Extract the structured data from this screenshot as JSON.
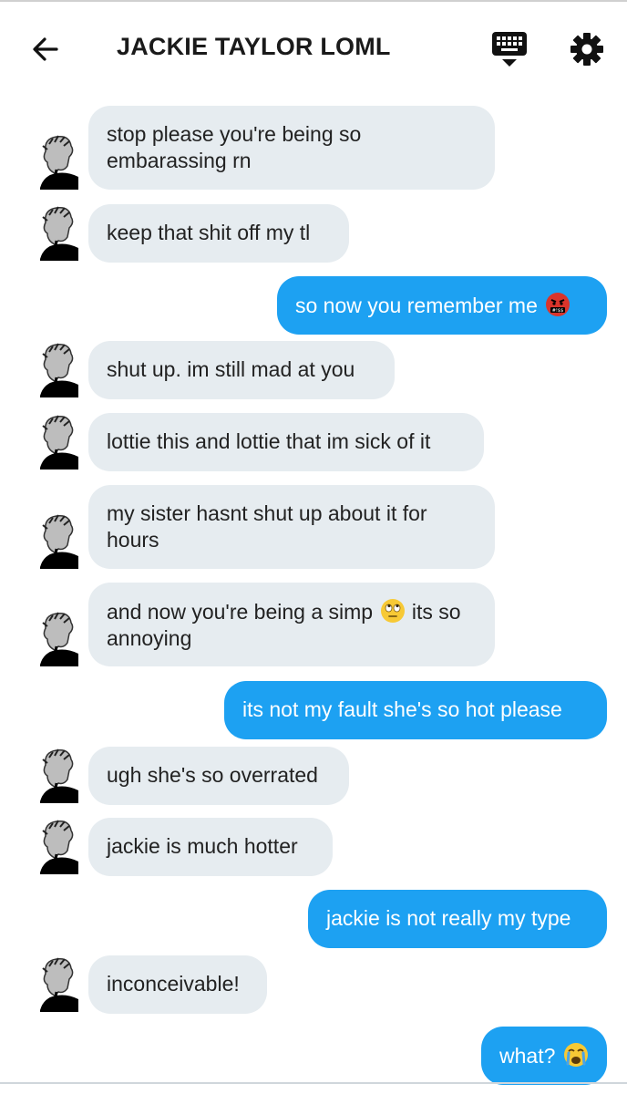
{
  "header": {
    "title": "JACKIE TAYLOR LOML",
    "icons": [
      "back-arrow-icon",
      "keyboard-icon",
      "gear-icon"
    ]
  },
  "messages": [
    {
      "side": "in",
      "text": "stop please you're being so embarassing rn"
    },
    {
      "side": "in",
      "text": "keep that shit off my tl"
    },
    {
      "side": "out",
      "text": "so now you remember me",
      "emoji": "angry-cursing-face"
    },
    {
      "side": "in",
      "text": "shut up. im still mad at you"
    },
    {
      "side": "in",
      "text": "lottie this and lottie that im sick of it"
    },
    {
      "side": "in",
      "text": "my sister hasnt shut up about it for hours"
    },
    {
      "side": "in",
      "text_before": "and now you're being a simp",
      "emoji": "eye-roll-face",
      "text_after": "its so annoying"
    },
    {
      "side": "out",
      "text": "its not my fault she's so hot please"
    },
    {
      "side": "in",
      "text": "ugh she's so overrated"
    },
    {
      "side": "in",
      "text": "jackie is much hotter"
    },
    {
      "side": "out",
      "text": "jackie is not really my type"
    },
    {
      "side": "in",
      "text": "inconceivable!"
    },
    {
      "side": "out",
      "text": "what?",
      "emoji": "crying-face"
    }
  ],
  "colors": {
    "incoming_bubble": "#e6ecf0",
    "outgoing_bubble": "#1da1f2",
    "outgoing_text": "#ffffff"
  }
}
